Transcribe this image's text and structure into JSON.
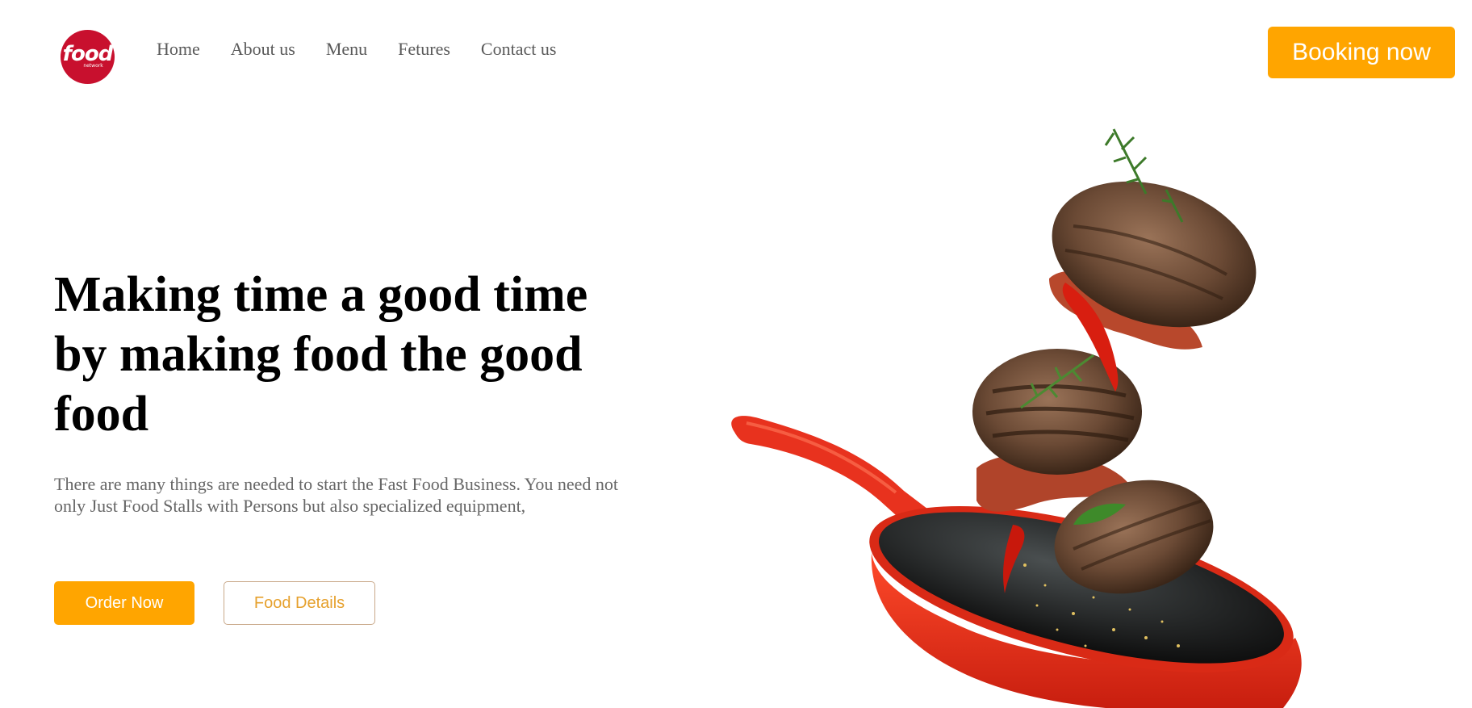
{
  "logo": {
    "word": "food",
    "sub": "network"
  },
  "nav": {
    "items": [
      {
        "label": "Home"
      },
      {
        "label": "About us"
      },
      {
        "label": "Menu"
      },
      {
        "label": "Fetures"
      },
      {
        "label": "Contact us"
      }
    ]
  },
  "header": {
    "booking_label": "Booking now"
  },
  "hero": {
    "headline": "Making time a good time by making food the good food",
    "description": "There are many things are needed to start the Fast Food Business. You need not only Just Food Stalls with Persons but also specialized equipment,",
    "order_label": "Order Now",
    "details_label": "Food Details"
  },
  "colors": {
    "accent": "#ffa500",
    "logo_red": "#c8102e",
    "pan_red": "#e8321e",
    "text_gray": "#666666"
  }
}
